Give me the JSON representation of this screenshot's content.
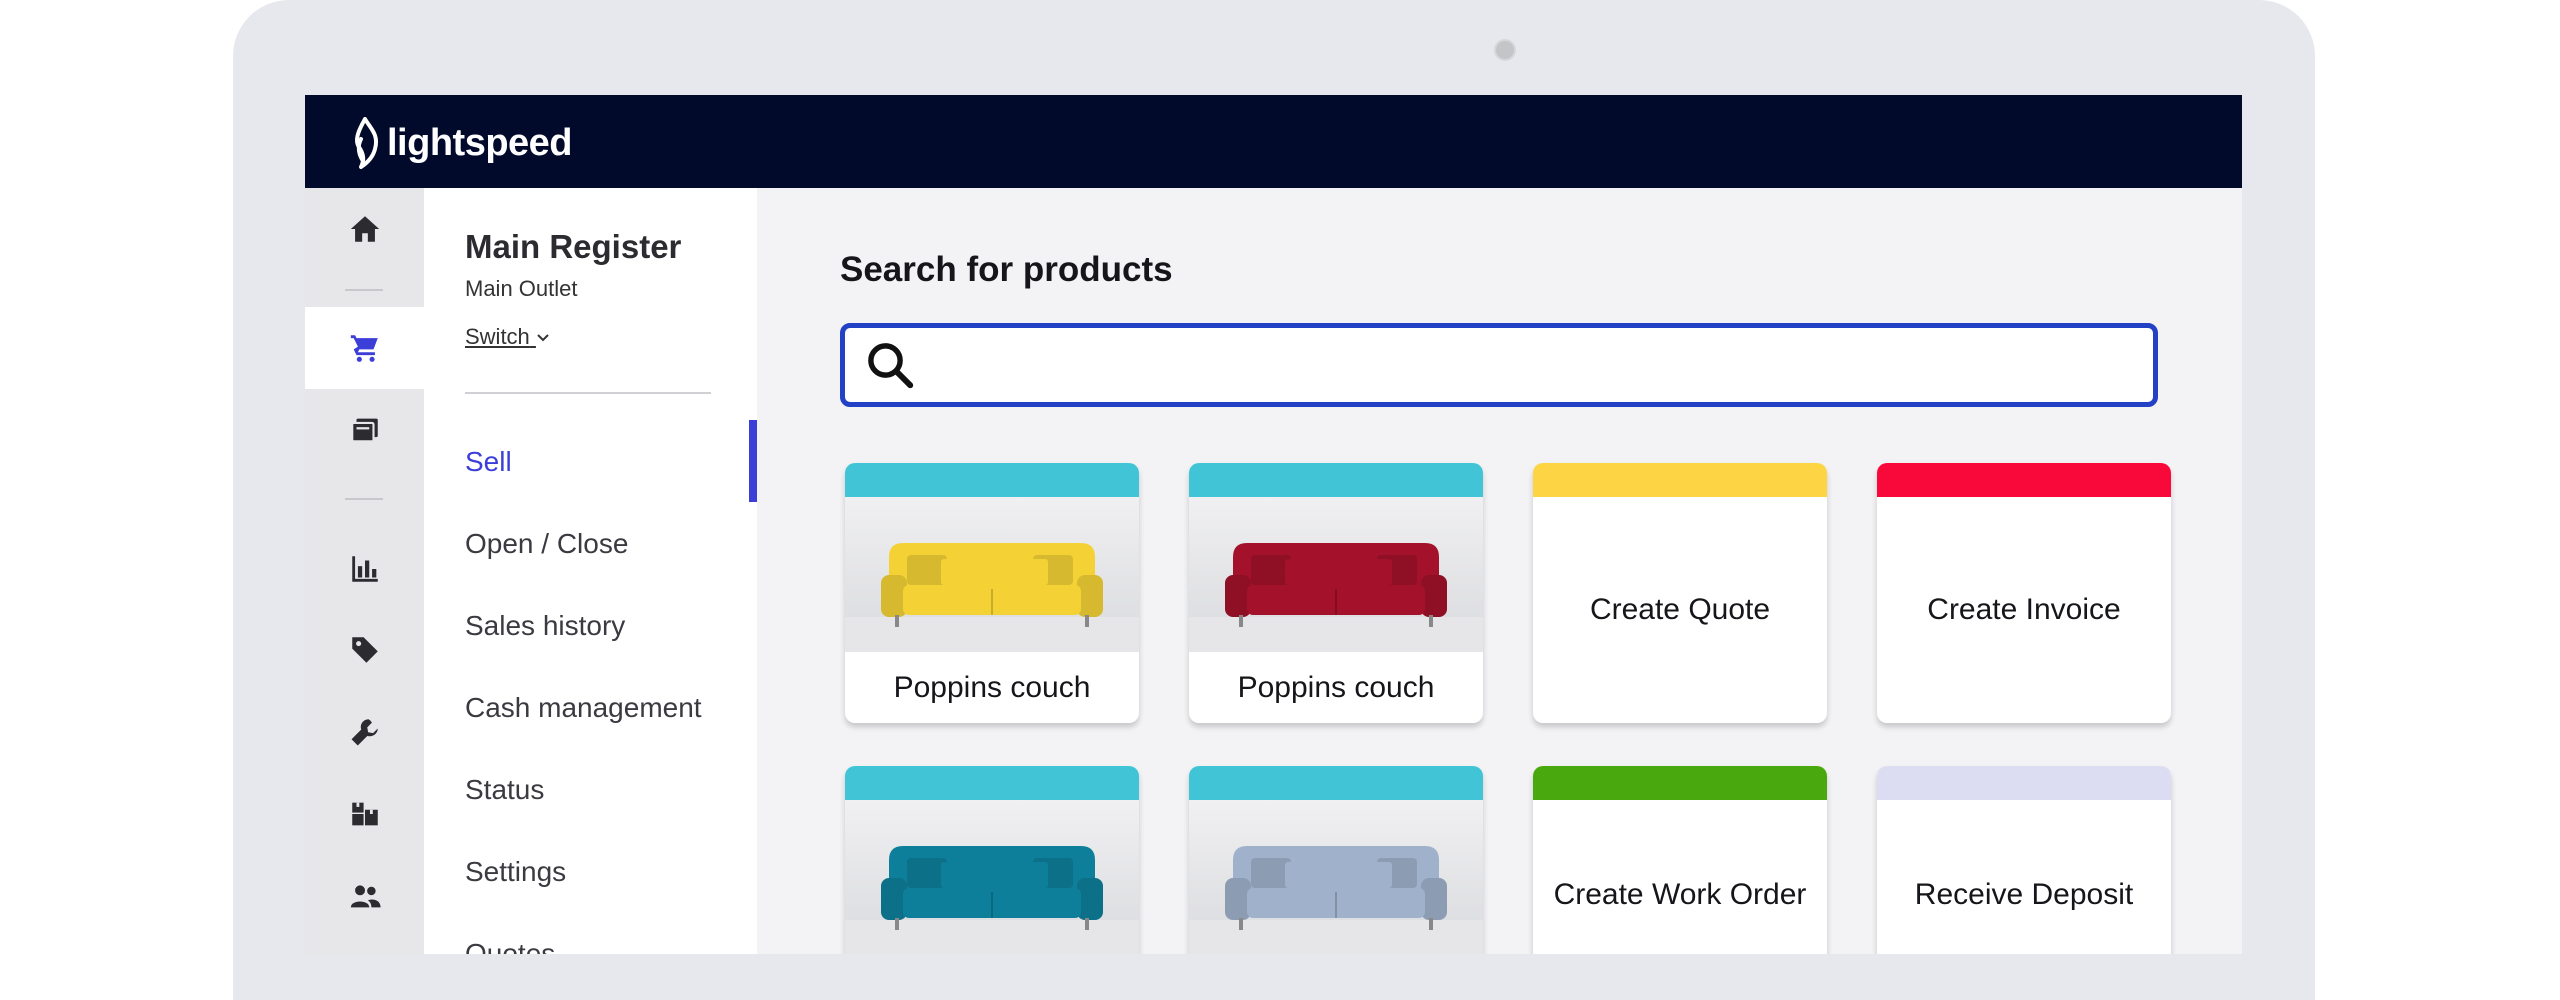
{
  "brand": {
    "name": "lightspeed"
  },
  "register": {
    "title": "Main Register",
    "outlet": "Main Outlet",
    "switch_label": "Switch"
  },
  "nav": {
    "items": [
      {
        "label": "Sell",
        "active": true
      },
      {
        "label": "Open / Close"
      },
      {
        "label": "Sales history"
      },
      {
        "label": "Cash management"
      },
      {
        "label": "Status"
      },
      {
        "label": "Settings"
      },
      {
        "label": "Quotes"
      }
    ]
  },
  "rail": {
    "icons": [
      "home-icon",
      "cart-icon",
      "catalog-icon",
      "reports-icon",
      "tag-icon",
      "wrench-icon",
      "inventory-icon",
      "customers-icon"
    ]
  },
  "search": {
    "title": "Search for products",
    "placeholder": ""
  },
  "tiles": [
    {
      "label": "Poppins couch",
      "kind": "product",
      "band_color": "#40c4d6",
      "couch_color": "#f4d235"
    },
    {
      "label": "Poppins couch",
      "kind": "product",
      "band_color": "#40c4d6",
      "couch_color": "#a3112a"
    },
    {
      "label": "Create Quote",
      "kind": "action",
      "band_color": "#fdd444"
    },
    {
      "label": "Create Invoice",
      "kind": "action",
      "band_color": "#f9083a"
    },
    {
      "label": "",
      "kind": "product",
      "band_color": "#40c4d6",
      "couch_color": "#0e7f9a"
    },
    {
      "label": "",
      "kind": "product",
      "band_color": "#40c4d6",
      "couch_color": "#9fb1cb"
    },
    {
      "label": "Create Work Order",
      "kind": "action",
      "band_color": "#4aa80f"
    },
    {
      "label": "Receive Deposit",
      "kind": "action",
      "band_color": "#dcdcf3"
    }
  ],
  "colors": {
    "topbar": "#020a2b",
    "accent": "#3b3fd8",
    "search_border": "#2241c5"
  }
}
